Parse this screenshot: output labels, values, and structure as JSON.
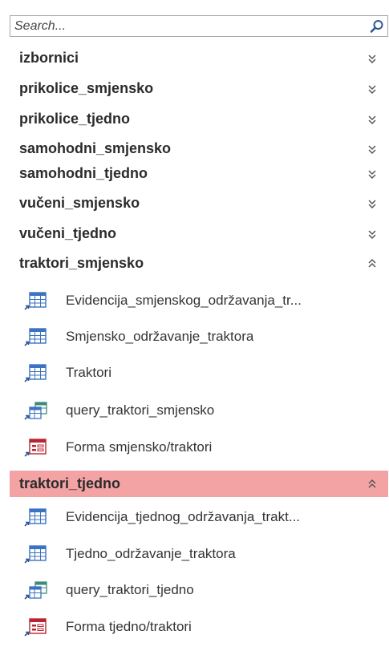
{
  "search": {
    "placeholder": "Search..."
  },
  "groups": [
    {
      "label": "izbornici",
      "state": "collapsed"
    },
    {
      "label": "prikolice_smjensko",
      "state": "collapsed"
    },
    {
      "label": "prikolice_tjedno",
      "state": "collapsed"
    },
    {
      "label": "samohodni_smjensko",
      "state": "collapsed"
    },
    {
      "label": "samohodni_tjedno",
      "state": "collapsed"
    },
    {
      "label": "vučeni_smjensko",
      "state": "collapsed"
    },
    {
      "label": "vučeni_tjedno",
      "state": "collapsed"
    },
    {
      "label": "traktori_smjensko",
      "state": "expanded",
      "items": [
        {
          "label": "Evidencija_smjenskog_održavanja_tr...",
          "icon": "table-icon"
        },
        {
          "label": "Smjensko_održavanje_traktora",
          "icon": "table-icon"
        },
        {
          "label": "Traktori",
          "icon": "table-icon"
        },
        {
          "label": "query_traktori_smjensko",
          "icon": "query-icon"
        },
        {
          "label": "Forma smjensko/traktori",
          "icon": "form-icon"
        }
      ]
    },
    {
      "label": "traktori_tjedno",
      "state": "expanded",
      "selected": true,
      "items": [
        {
          "label": "Evidencija_tjednog_održavanja_trakt...",
          "icon": "table-icon"
        },
        {
          "label": "Tjedno_održavanje_traktora",
          "icon": "table-icon"
        },
        {
          "label": "query_traktori_tjedno",
          "icon": "query-icon"
        },
        {
          "label": "Forma tjedno/traktori",
          "icon": "form-icon"
        }
      ]
    }
  ],
  "colors": {
    "selected_group_bg": "#f4a3a5",
    "table_icon": "#3c72c2",
    "query_icon": "#3d8a7a",
    "form_icon": "#b8242f",
    "link_arrow": "#2b5797"
  }
}
